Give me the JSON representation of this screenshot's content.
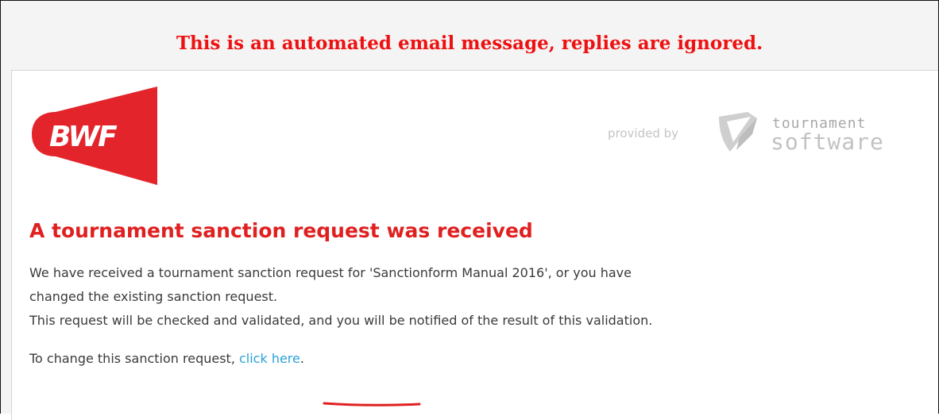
{
  "email": {
    "notice": "This is an automated email message, replies are ignored.",
    "header": {
      "logo_text": "BWF",
      "provided_by": "provided by",
      "brand_line1": "tournament",
      "brand_line2": "software"
    },
    "heading": "A tournament sanction request was received",
    "paragraph": {
      "line1": "We have received a tournament sanction request for 'Sanctionform Manual 2016', or you have",
      "line2": "changed the existing sanction request.",
      "line3": "This request will be checked and validated, and you will be notified of the result of this validation."
    },
    "change": {
      "prefix": "To change this sanction request, ",
      "link_label": "click here",
      "suffix": "."
    }
  },
  "colors": {
    "notice": "#ee1111",
    "brand_red": "#e3242b",
    "link": "#2aa1d9",
    "annotation_underline": "#e02020"
  },
  "icons": {
    "brand_logo": "bwf-logo",
    "provider_logo": "tournament-software-shield-icon"
  }
}
